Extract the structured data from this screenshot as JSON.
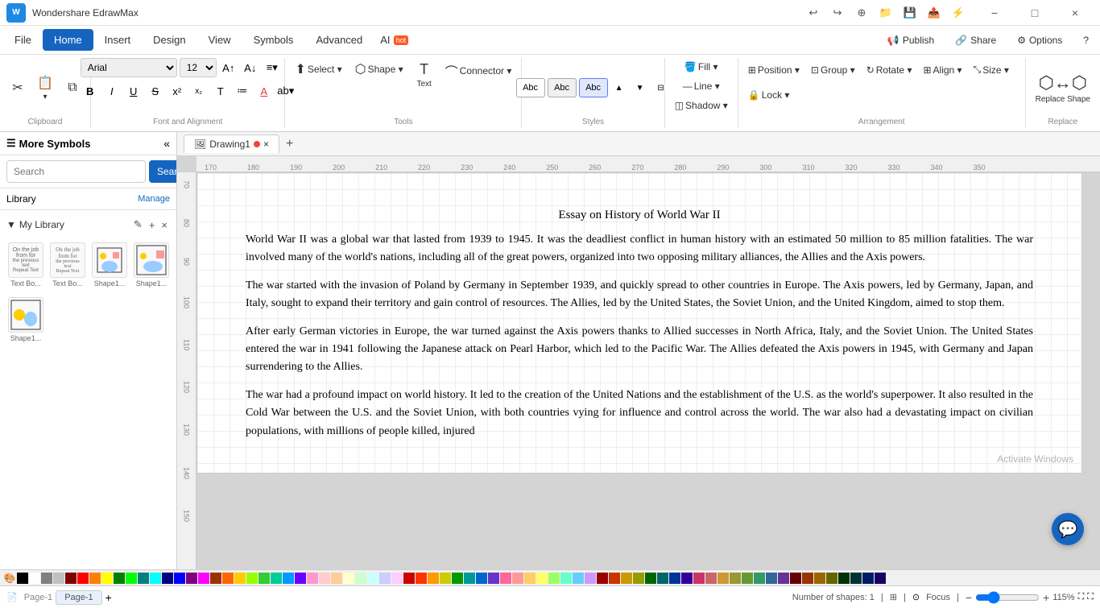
{
  "app": {
    "name": "Wondershare EdrawMax",
    "logo": "W"
  },
  "title_controls": {
    "minimize": "−",
    "maximize": "□",
    "close": "×"
  },
  "title_icons": [
    "↩",
    "↪",
    "⊕",
    "📁",
    "💾",
    "📤",
    "⚡"
  ],
  "menus": {
    "items": [
      "File",
      "Home",
      "Insert",
      "Design",
      "View",
      "Symbols",
      "Advanced"
    ],
    "active": "Home",
    "right": [
      {
        "label": "Publish",
        "icon": "📢"
      },
      {
        "label": "Share",
        "icon": "🔗"
      },
      {
        "label": "Options",
        "icon": "⚙"
      },
      {
        "label": "?",
        "icon": "?"
      }
    ]
  },
  "ribbon": {
    "clipboard": {
      "label": "Clipboard",
      "buttons": [
        "✂",
        "📋",
        "⧉"
      ]
    },
    "font": {
      "label": "Font and Alignment",
      "family": "Arial",
      "size": "12",
      "bold": "B",
      "italic": "I",
      "underline": "U",
      "strikethrough": "S",
      "superscript": "x²",
      "subscript": "x₂",
      "text_btn": "T",
      "align_btn": "≡",
      "list_btn": "≔",
      "color_btn": "A",
      "increase": "A↑",
      "decrease": "A↓"
    },
    "tools": {
      "label": "Tools",
      "select": "Select",
      "shape": "Shape",
      "text": "Text",
      "connector": "Connector"
    },
    "styles": {
      "label": "Styles",
      "shapes": [
        "Abc",
        "Abc",
        "Abc"
      ]
    },
    "fill": {
      "label": "",
      "fill": "Fill",
      "line": "Line",
      "shadow": "Shadow"
    },
    "arrangement": {
      "label": "Arrangement",
      "position": "Position",
      "group": "Group",
      "rotate": "Rotate",
      "align": "Align",
      "size": "Size",
      "lock": "Lock"
    },
    "replace": {
      "label": "Replace",
      "replace_shape": "Replace Shape"
    }
  },
  "sidebar": {
    "header": "More Symbols",
    "search_placeholder": "Search",
    "search_btn": "Search",
    "library_label": "Library",
    "manage_label": "Manage",
    "my_library": "My Library",
    "shapes": [
      {
        "label": "Text Bo..."
      },
      {
        "label": "Text Bo..."
      },
      {
        "label": "Shape1..."
      },
      {
        "label": "Shape1..."
      },
      {
        "label": "Shape1..."
      }
    ]
  },
  "tabs": {
    "drawing": "Drawing1",
    "add": "+"
  },
  "canvas": {
    "title": "Essay on History of World War II",
    "paragraphs": [
      "World War II was a global war that lasted from 1939 to 1945. It was the deadliest conflict in human history with an estimated 50 million to 85 million fatalities. The war involved many of the world's nations, including all of the great powers, organized into two opposing military alliances, the Allies and the Axis powers.",
      "The war started with the invasion of Poland by Germany in September 1939, and quickly spread to other countries in Europe. The Axis powers, led by Germany, Japan, and Italy, sought to expand their territory and gain control of resources. The Allies, led by the United States, the Soviet Union, and the United Kingdom, aimed to stop them.",
      "After early German victories in Europe, the war turned against the Axis powers thanks to Allied successes in North Africa, Italy, and the Soviet Union. The United States entered the war in 1941 following the Japanese attack on Pearl Harbor, which led to the Pacific War. The Allies defeated the Axis powers in 1945, with Germany and Japan surrendering to the Allies.",
      "The war had a profound impact on world history. It led to the creation of the United Nations and the establishment of the U.S. as the world's superpower. It also resulted in the Cold War between the U.S. and the Soviet Union, with both countries vying for influence and control across the world. The war also had a devastating impact on civilian populations, with millions of people killed, injured"
    ]
  },
  "status_bar": {
    "page_label": "Page-1",
    "page_tab": "Page-1",
    "shapes_count": "Number of shapes: 1",
    "focus": "Focus",
    "zoom": "115%"
  },
  "colors": [
    "#000000",
    "#ffffff",
    "#808080",
    "#c0c0c0",
    "#800000",
    "#ff0000",
    "#ff8000",
    "#ffff00",
    "#008000",
    "#00ff00",
    "#008080",
    "#00ffff",
    "#000080",
    "#0000ff",
    "#800080",
    "#ff00ff",
    "#993300",
    "#ff6600",
    "#ffcc00",
    "#99ff00",
    "#33cc33",
    "#00cc99",
    "#0099ff",
    "#6600ff",
    "#ff99cc",
    "#ffcccc",
    "#ffcc99",
    "#ffffcc",
    "#ccffcc",
    "#ccffff",
    "#ccccff",
    "#ffccff",
    "#cc0000",
    "#ff3300",
    "#ff9900",
    "#cccc00",
    "#009900",
    "#009999",
    "#0066cc",
    "#6633cc",
    "#ff6699",
    "#ff9999",
    "#ffcc66",
    "#ffff66",
    "#99ff66",
    "#66ffcc",
    "#66ccff",
    "#cc99ff",
    "#990000",
    "#cc3300",
    "#cc9900",
    "#999900",
    "#006600",
    "#006666",
    "#003399",
    "#330099",
    "#cc3366",
    "#cc6666",
    "#cc9933",
    "#999933",
    "#669933",
    "#339966",
    "#336699",
    "#663399",
    "#660000",
    "#993300",
    "#996600",
    "#666600",
    "#003300",
    "#003333",
    "#001a66",
    "#1a0066"
  ],
  "activate_text": "Activate Windows"
}
